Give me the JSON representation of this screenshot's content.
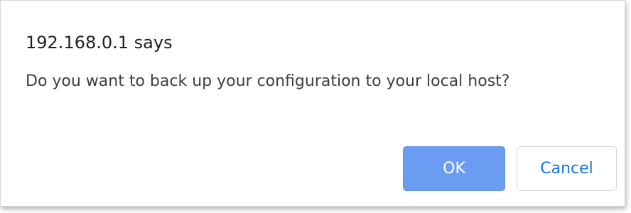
{
  "dialog": {
    "title": "192.168.0.1 says",
    "message": "Do you want to back up your configuration to your local host?",
    "buttons": {
      "ok_label": "OK",
      "cancel_label": "Cancel"
    }
  },
  "colors": {
    "ok_button_bg": "#6a9cf2",
    "ok_button_text": "#ffffff",
    "cancel_button_text": "#1a73e8",
    "dialog_bg": "#ffffff"
  }
}
